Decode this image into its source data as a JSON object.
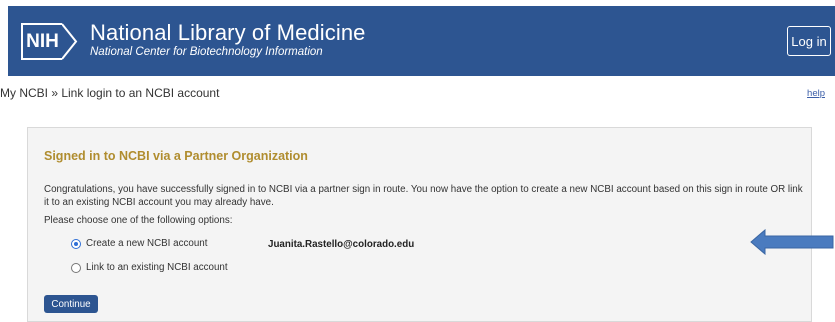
{
  "header": {
    "logo_text": "NIH",
    "title": "National Library of Medicine",
    "subtitle": "National Center for Biotechnology Information",
    "login_label": "Log in"
  },
  "breadcrumb": "My NCBI » Link login to an NCBI account",
  "help_label": "help",
  "panel": {
    "title": "Signed in to NCBI via a Partner Organization",
    "intro": "Congratulations, you have successfully signed in to NCBI via a partner sign in route. You now have the option to create a new NCBI account based on this sign in route OR link it to an existing NCBI account you may already have.",
    "choose_label": "Please choose one of the following options:",
    "options": [
      {
        "label": "Create a new NCBI account",
        "checked": true
      },
      {
        "label": "Link to an existing NCBI account",
        "checked": false
      }
    ],
    "email": "Juanita.Rastello@colorado.edu",
    "continue_label": "Continue"
  },
  "colors": {
    "header_bg": "#2d5591",
    "title_gold": "#b08d2f",
    "annotation_arrow": "#4a7bbf"
  }
}
